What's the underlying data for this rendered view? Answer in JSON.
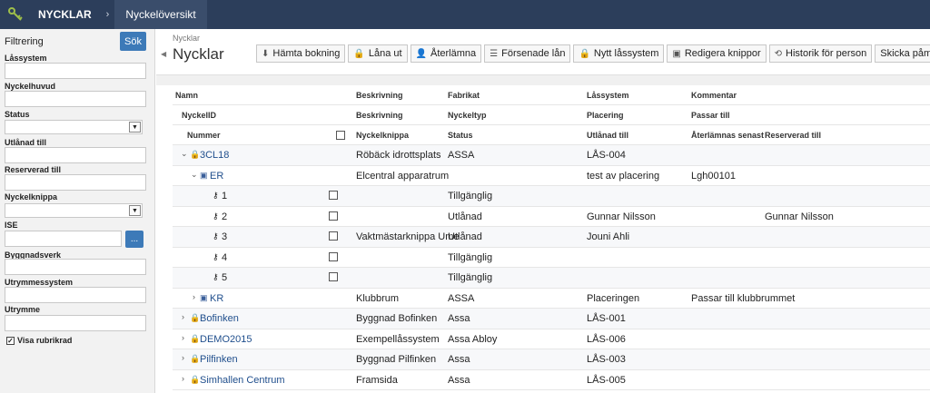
{
  "topbar": {
    "brand": "NYCKLAR",
    "separator": "›",
    "crumb": "Nyckelöversikt"
  },
  "filter": {
    "title": "Filtrering",
    "search_button": "Sök",
    "fields": {
      "lassystem": "Låssystem",
      "nyckelhuvud": "Nyckelhuvud",
      "status": "Status",
      "utlanad_till": "Utlånad till",
      "reserverad_till": "Reserverad till",
      "nyckelknippa": "Nyckelknippa",
      "ise": "ISE",
      "byggnadsverk": "Byggnadsverk",
      "utrymmessystem": "Utrymmessystem",
      "utrymme": "Utrymme"
    },
    "ise_button": "...",
    "show_header": "Visa rubrikrad"
  },
  "page": {
    "breadcrumb": "Nycklar",
    "title": "Nycklar"
  },
  "toolbar": {
    "hamta": "Hämta bokning",
    "lana": "Låna ut",
    "aterlamna": "Återlämna",
    "forsenade": "Försenade lån",
    "nytt": "Nytt låssystem",
    "redigera": "Redigera knippor",
    "historik": "Historik för person",
    "skicka": "Skicka påminnelser"
  },
  "headers": {
    "row1": {
      "namn": "Namn",
      "beskrivning": "Beskrivning",
      "fabrikat": "Fabrikat",
      "lassystem": "Låssystem",
      "kommentar": "Kommentar"
    },
    "row2": {
      "nyckelid": "NyckelID",
      "beskrivning": "Beskrivning",
      "nyckeltyp": "Nyckeltyp",
      "placering": "Placering",
      "passar": "Passar till"
    },
    "row3": {
      "nummer": "Nummer",
      "nyckelknippa": "Nyckelknippa",
      "status": "Status",
      "utlanad": "Utlånad till",
      "aterlamnas": "Återlämnas senast",
      "reserverad": "Reserverad till"
    }
  },
  "rows": [
    {
      "toggle": "⌄",
      "icon": "🔒",
      "name": "3CL18",
      "desc": "Röbäck idrottsplats",
      "fab": "ASSA",
      "las": "LÅS-004",
      "kom": "",
      "extra": ""
    },
    {
      "toggle": "⌄",
      "icon": "▣",
      "name": "ER",
      "desc": "Elcentral apparatrum",
      "fab": "",
      "las": "test av placering",
      "kom": "Lgh00101",
      "extra": ""
    },
    {
      "name": "1",
      "desc": "",
      "fab": "Tillgänglig",
      "las": "",
      "kom": "",
      "extra": ""
    },
    {
      "name": "2",
      "desc": "",
      "fab": "Utlånad",
      "las": "Gunnar Nilsson",
      "kom": "",
      "extra": "Gunnar Nilsson"
    },
    {
      "name": "3",
      "desc": "Vaktmästarknippa Ume",
      "fab": "Utlånad",
      "las": "Jouni Ahli",
      "kom": "",
      "extra": ""
    },
    {
      "name": "4",
      "desc": "",
      "fab": "Tillgänglig",
      "las": "",
      "kom": "",
      "extra": ""
    },
    {
      "name": "5",
      "desc": "",
      "fab": "Tillgänglig",
      "las": "",
      "kom": "",
      "extra": ""
    },
    {
      "toggle": "›",
      "icon": "▣",
      "name": "KR",
      "desc": "Klubbrum",
      "fab": "ASSA",
      "las": "Placeringen",
      "kom": "Passar till klubbrummet",
      "extra": ""
    },
    {
      "toggle": "›",
      "icon": "🔒",
      "name": "Bofinken",
      "desc": "Byggnad Bofinken",
      "fab": "Assa",
      "las": "LÅS-001",
      "kom": "",
      "extra": ""
    },
    {
      "toggle": "›",
      "icon": "🔒",
      "name": "DEMO2015",
      "desc": "Exempellåssystem",
      "fab": "Assa Abloy",
      "las": "LÅS-006",
      "kom": "",
      "extra": ""
    },
    {
      "toggle": "›",
      "icon": "🔒",
      "name": "Pilfinken",
      "desc": "Byggnad Pilfinken",
      "fab": "Assa",
      "las": "LÅS-003",
      "kom": "",
      "extra": ""
    },
    {
      "toggle": "›",
      "icon": "🔒",
      "name": "Simhallen Centrum",
      "desc": "Framsida",
      "fab": "Assa",
      "las": "LÅS-005",
      "kom": "",
      "extra": ""
    }
  ]
}
